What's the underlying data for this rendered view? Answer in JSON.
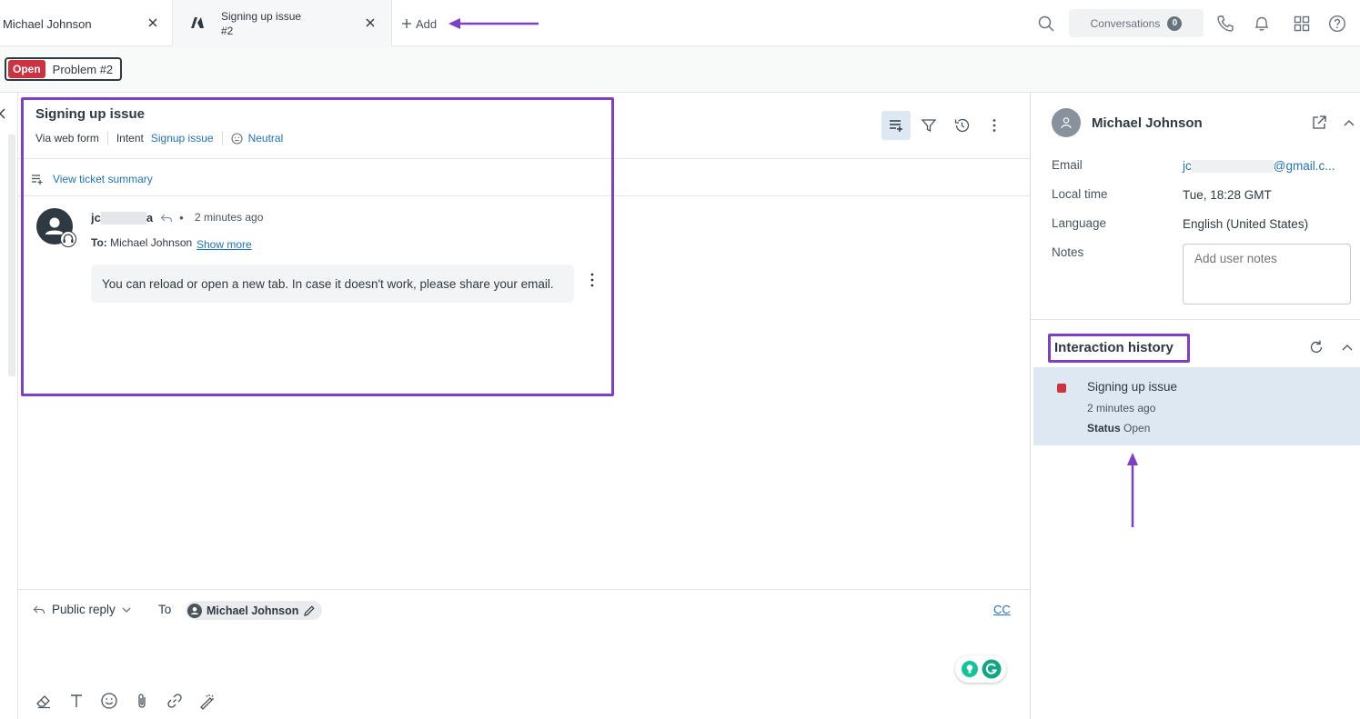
{
  "tabs": [
    {
      "label": "Michael Johnson"
    },
    {
      "label": "Signing up issue",
      "sublabel": "#2"
    }
  ],
  "add_tab_label": "Add",
  "conversations": {
    "label": "Conversations",
    "count": "0"
  },
  "ticket_pill": {
    "status": "Open",
    "title": "Problem #2"
  },
  "ticket": {
    "title": "Signing up issue",
    "via": "Via web form",
    "intent_label": "Intent",
    "intent_value": "Signup issue",
    "sentiment": "Neutral",
    "summary_link": "View ticket summary"
  },
  "message": {
    "author_prefix": "jc",
    "author_suffix": "a",
    "bullet": "•",
    "time": "2 minutes ago",
    "to_label": "To:",
    "to_name": "Michael Johnson",
    "show_more": "Show more",
    "body": "You can reload or open a new tab. In case it doesn't work, please share your email."
  },
  "composer": {
    "reply_type": "Public reply",
    "to_label": "To",
    "recipient": "Michael Johnson",
    "cc": "CC"
  },
  "user": {
    "name": "Michael Johnson",
    "fields": {
      "email_label": "Email",
      "email_prefix": "jc",
      "email_suffix": "@gmail.c...",
      "local_time_label": "Local time",
      "local_time": "Tue, 18:28 GMT",
      "language_label": "Language",
      "language": "English (United States)",
      "notes_label": "Notes",
      "notes_placeholder": "Add user notes"
    }
  },
  "interaction_history": {
    "title": "Interaction history",
    "items": [
      {
        "title": "Signing up issue",
        "time": "2 minutes ago",
        "status_label": "Status",
        "status": "Open"
      }
    ]
  },
  "colors": {
    "accent": "#1f73b7",
    "open_status": "#cc3340",
    "annotation": "#7d3fc4",
    "selected_row": "#dde8f2"
  }
}
